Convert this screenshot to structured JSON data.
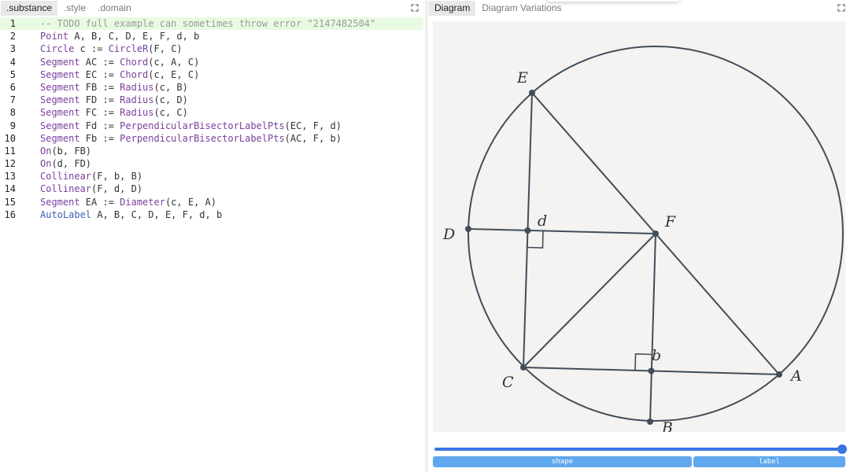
{
  "left_tabs": [
    ".substance",
    ".style",
    ".domain"
  ],
  "right_tabs": [
    "Diagram",
    "Diagram Variations"
  ],
  "code_lines": [
    [
      {
        "t": "-- TODO full example can sometimes throw error \"2147482504\"",
        "c": "comment"
      }
    ],
    [
      {
        "t": "Point",
        "c": "type"
      },
      {
        "t": " A, B, C, D, E, F, d, b",
        "c": "plain"
      }
    ],
    [
      {
        "t": "Circle",
        "c": "type"
      },
      {
        "t": " c := ",
        "c": "plain"
      },
      {
        "t": "CircleR",
        "c": "fn"
      },
      {
        "t": "(F, C)",
        "c": "plain"
      }
    ],
    [
      {
        "t": "Segment",
        "c": "type"
      },
      {
        "t": " AC := ",
        "c": "plain"
      },
      {
        "t": "Chord",
        "c": "fn"
      },
      {
        "t": "(c, A, C)",
        "c": "plain"
      }
    ],
    [
      {
        "t": "Segment",
        "c": "type"
      },
      {
        "t": " EC := ",
        "c": "plain"
      },
      {
        "t": "Chord",
        "c": "fn"
      },
      {
        "t": "(c, E, C)",
        "c": "plain"
      }
    ],
    [
      {
        "t": "Segment",
        "c": "type"
      },
      {
        "t": " FB := ",
        "c": "plain"
      },
      {
        "t": "Radius",
        "c": "fn"
      },
      {
        "t": "(c, B)",
        "c": "plain"
      }
    ],
    [
      {
        "t": "Segment",
        "c": "type"
      },
      {
        "t": " FD := ",
        "c": "plain"
      },
      {
        "t": "Radius",
        "c": "fn"
      },
      {
        "t": "(c, D)",
        "c": "plain"
      }
    ],
    [
      {
        "t": "Segment",
        "c": "type"
      },
      {
        "t": " FC := ",
        "c": "plain"
      },
      {
        "t": "Radius",
        "c": "fn"
      },
      {
        "t": "(c, C)",
        "c": "plain"
      }
    ],
    [
      {
        "t": "Segment",
        "c": "type"
      },
      {
        "t": " Fd := ",
        "c": "plain"
      },
      {
        "t": "PerpendicularBisectorLabelPts",
        "c": "fn"
      },
      {
        "t": "(EC, F, d)",
        "c": "plain"
      }
    ],
    [
      {
        "t": "Segment",
        "c": "type"
      },
      {
        "t": " Fb := ",
        "c": "plain"
      },
      {
        "t": "PerpendicularBisectorLabelPts",
        "c": "fn"
      },
      {
        "t": "(AC, F, b)",
        "c": "plain"
      }
    ],
    [
      {
        "t": "On",
        "c": "fn"
      },
      {
        "t": "(b, FB)",
        "c": "plain"
      }
    ],
    [
      {
        "t": "On",
        "c": "fn"
      },
      {
        "t": "(d, FD)",
        "c": "plain"
      }
    ],
    [
      {
        "t": "Collinear",
        "c": "fn"
      },
      {
        "t": "(F, b, B)",
        "c": "plain"
      }
    ],
    [
      {
        "t": "Collinear",
        "c": "fn"
      },
      {
        "t": "(F, d, D)",
        "c": "plain"
      }
    ],
    [
      {
        "t": "Segment",
        "c": "type"
      },
      {
        "t": " EA := ",
        "c": "plain"
      },
      {
        "t": "Diameter",
        "c": "fn"
      },
      {
        "t": "(c, E, A)",
        "c": "plain"
      }
    ],
    [
      {
        "t": "AutoLabel",
        "c": "kw"
      },
      {
        "t": " A, B, C, D, E, F, d, b",
        "c": "plain"
      }
    ]
  ],
  "diagram": {
    "labels": {
      "A": "A",
      "B": "B",
      "C": "C",
      "D": "D",
      "E": "E",
      "F": "F",
      "d": "d",
      "b": "b"
    }
  },
  "stage_buttons": [
    "shape",
    "label"
  ],
  "colors": {
    "ink": "#424d5a",
    "canvas": "#f4f3f1",
    "accent": "#3a74e0",
    "button": "#5fa8ee",
    "active_line": "#e8fbe2"
  },
  "icons": [
    "expand-icon"
  ]
}
